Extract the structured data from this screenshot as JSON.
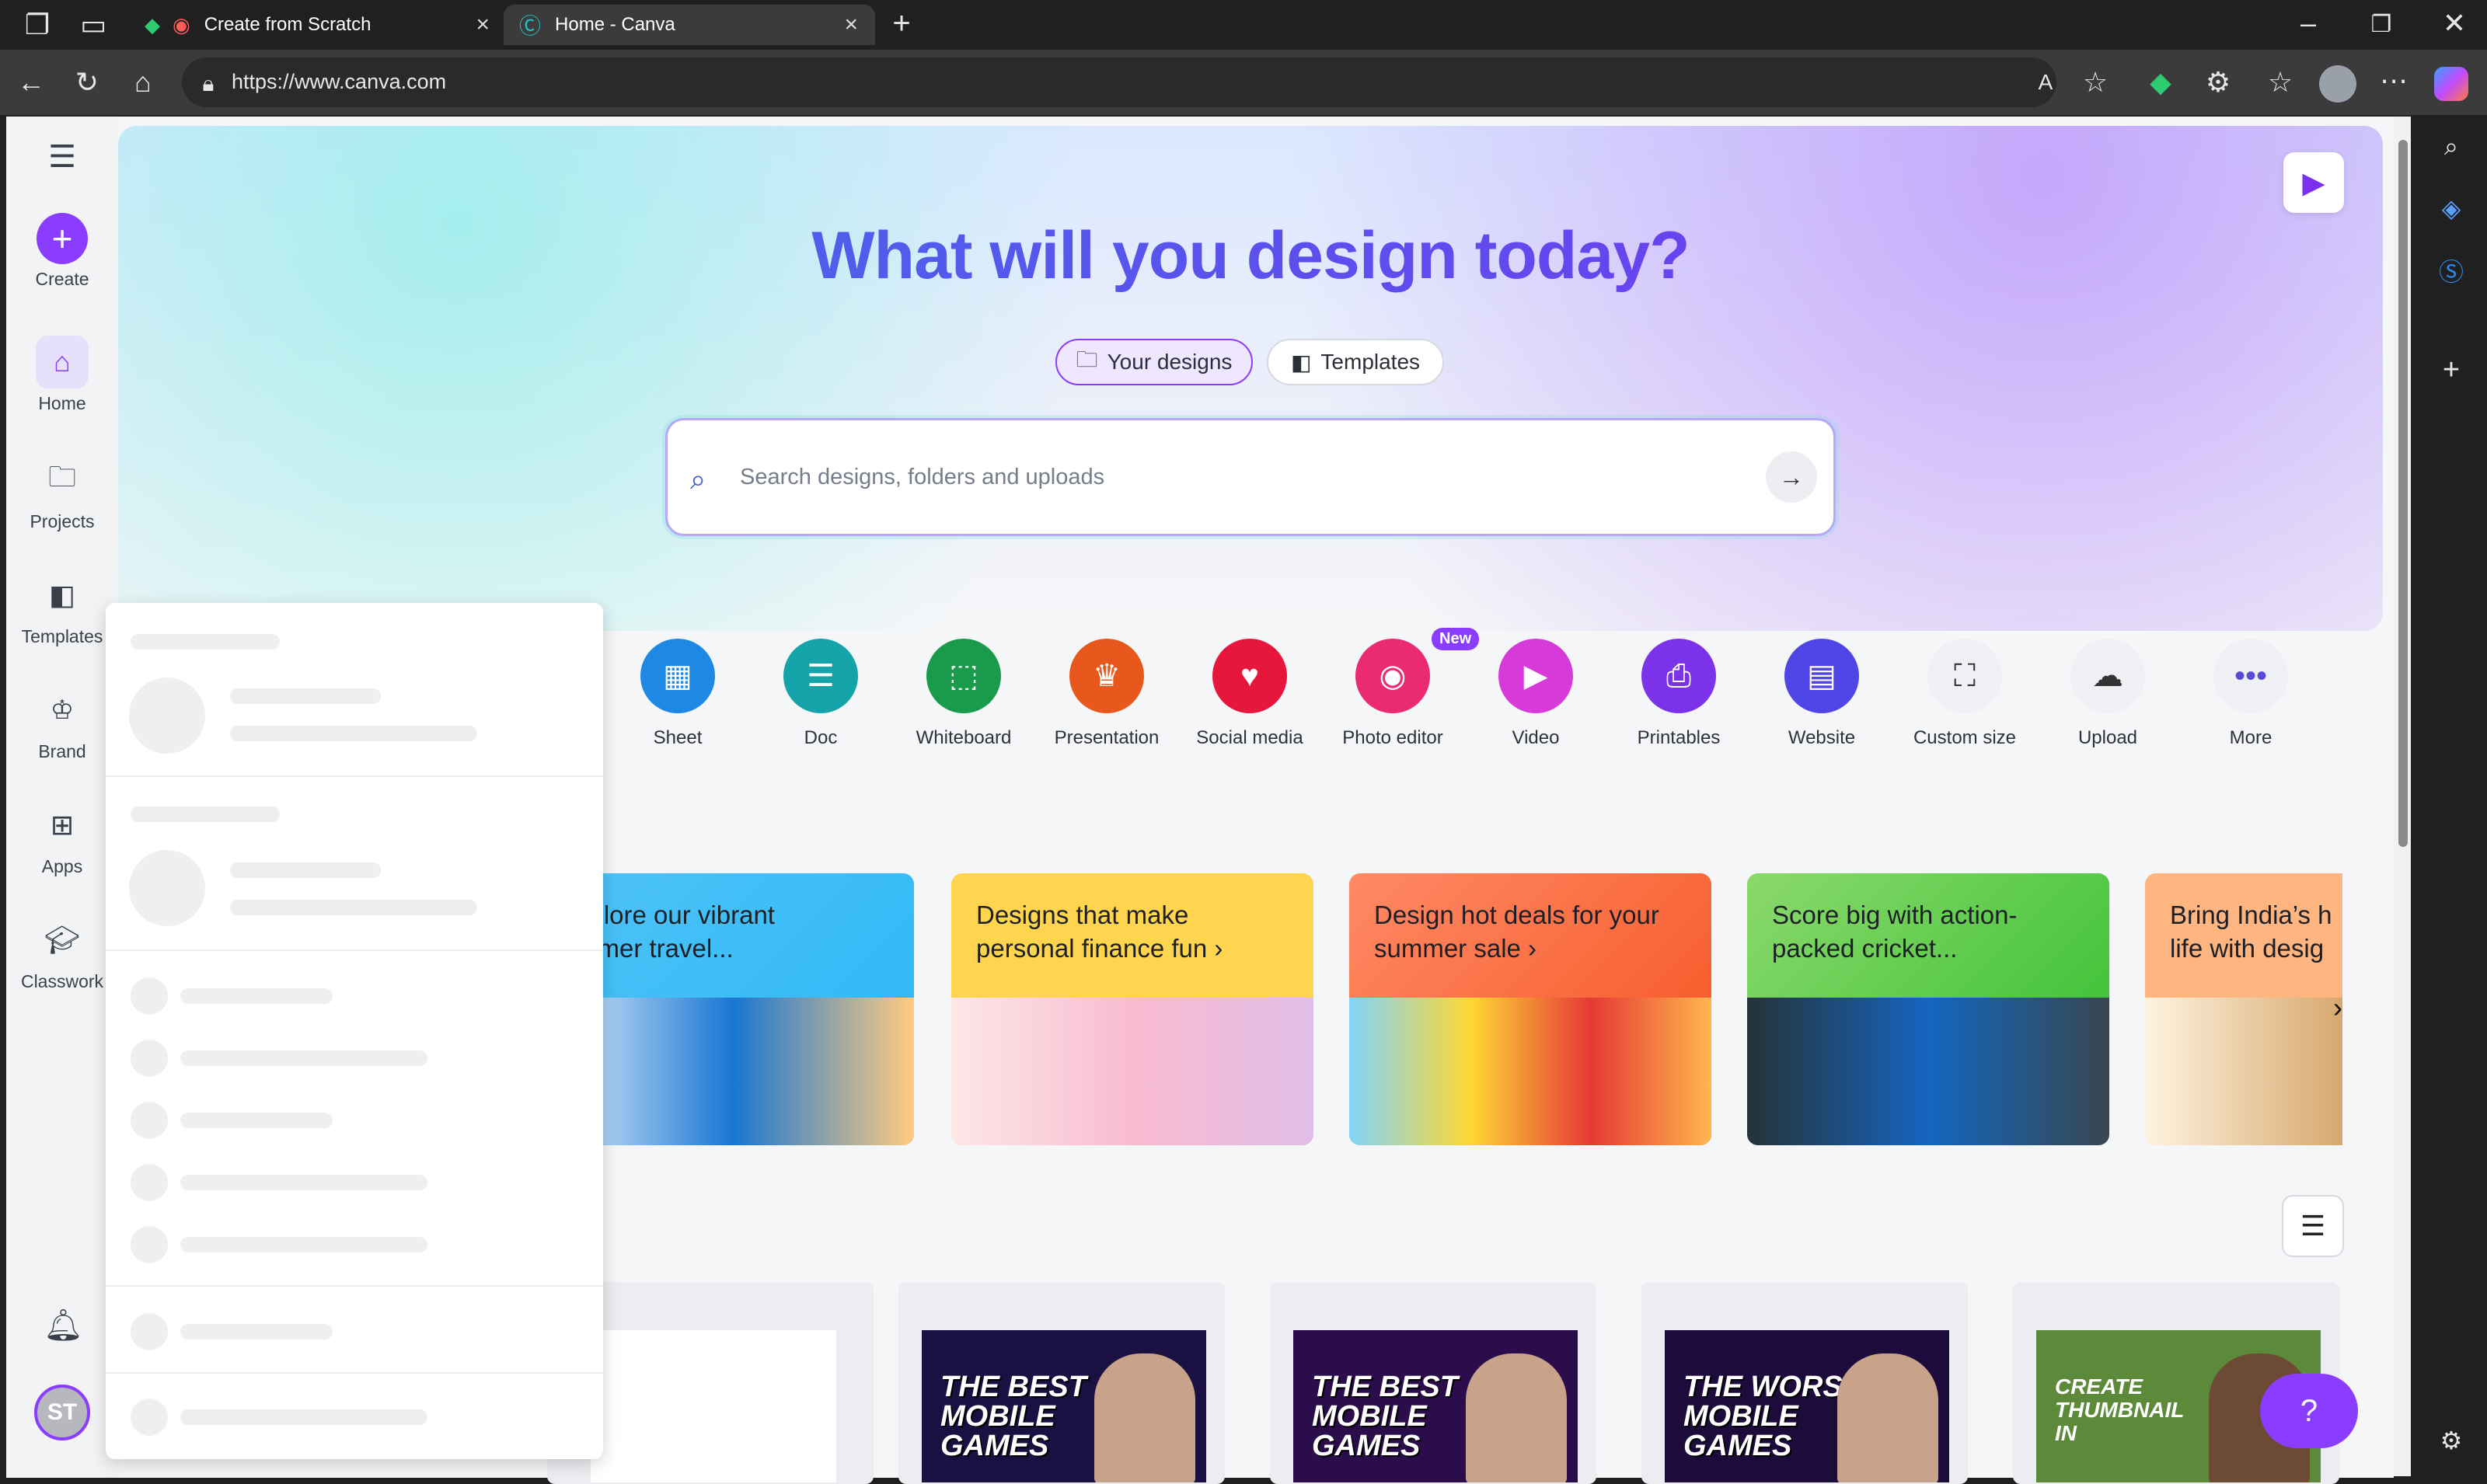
{
  "browser": {
    "tabs": [
      {
        "title": "Create from Scratch"
      },
      {
        "title": "Home - Canva"
      }
    ],
    "url": "https://www.canva.com"
  },
  "sidebar": {
    "create_label": "Create",
    "items": [
      {
        "label": "Home"
      },
      {
        "label": "Projects"
      },
      {
        "label": "Templates"
      },
      {
        "label": "Brand"
      },
      {
        "label": "Apps"
      },
      {
        "label": "Classwork"
      }
    ],
    "avatar_initials": "ST"
  },
  "hero": {
    "title": "What will you design today?",
    "tabs": [
      {
        "label": "Your designs"
      },
      {
        "label": "Templates"
      }
    ],
    "search_placeholder": "Search designs, folders and uploads"
  },
  "quick_tools": [
    {
      "label": "Sheet",
      "color": "#1e88e5"
    },
    {
      "label": "Doc",
      "color": "#13a3a8"
    },
    {
      "label": "Whiteboard",
      "color": "#1a9b4b"
    },
    {
      "label": "Presentation",
      "color": "#e8581c"
    },
    {
      "label": "Social media",
      "color": "#e6163d"
    },
    {
      "label": "Photo editor",
      "color": "#ea2b72",
      "badge": "New"
    },
    {
      "label": "Video",
      "color": "#d63bd9"
    },
    {
      "label": "Printables",
      "color": "#7b32e8"
    },
    {
      "label": "Website",
      "color": "#4f46e5"
    },
    {
      "label": "Custom size",
      "color": "#eef0f3"
    },
    {
      "label": "Upload",
      "color": "#eef0f3"
    },
    {
      "label": "More",
      "color": "#eef0f3"
    }
  ],
  "banners": [
    {
      "title": "xplore our vibrant\nmmer travel...",
      "color": "#4fc3f7"
    },
    {
      "title": "Designs that make\npersonal finance fun  ›",
      "color": "#ffd54f"
    },
    {
      "title": "Design hot deals for your\nsummer sale  ›",
      "color": "#ff8a65"
    },
    {
      "title": "Score big with action-\npacked cricket...",
      "color": "#8bd96b"
    },
    {
      "title": "Bring India’s h\nlife with desig",
      "color": "#ffb580"
    }
  ],
  "designs": [
    {
      "text": ""
    },
    {
      "text": "THE BEST\nMOBILE\nGAMES"
    },
    {
      "text": "THE BEST\nMOBILE\nGAMES"
    },
    {
      "text": "THE WORST\nMOBILE\nGAMES"
    },
    {
      "text": "CREATE\nTHUMBNAIL\nIN"
    }
  ],
  "help_label": "?"
}
